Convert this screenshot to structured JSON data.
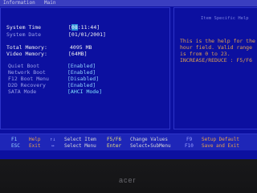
{
  "topbar": {
    "title": "Information",
    "tab": "Main"
  },
  "help": {
    "title": "Item Specific Help",
    "lines": [
      "This is the help for the",
      "hour field. Valid range",
      "is from 0 to 23.",
      "INCREASE/REDUCE : F5/F6"
    ]
  },
  "fields": [
    {
      "label": "System Time",
      "value_pre": "[",
      "value_hl": "08",
      "value_post": ":11:44]"
    },
    {
      "label": "System Date",
      "value": "[01/01/2001]"
    },
    {
      "label": "Total Memory:",
      "value": "4095 MB"
    },
    {
      "label": "Video Memory:",
      "value": "[64MB]"
    },
    {
      "label": "Quiet Boot",
      "value": "[Enabled]"
    },
    {
      "label": "Network Boot",
      "value": "[Enabled]"
    },
    {
      "label": "F12 Boot Menu",
      "value": "[Disabled]"
    },
    {
      "label": "D2D Recovery",
      "value": "[Enabled]"
    },
    {
      "label": "SATA Mode",
      "value": "[AHCI Mode]"
    }
  ],
  "footer": {
    "row1": {
      "k1": "F1",
      "a1": "Help",
      "k2": "↑↓",
      "a2": "Select Item",
      "k3": "F5/F6",
      "a3": "Change Values",
      "k4": "F9",
      "a4": "Setup Default"
    },
    "row2": {
      "k1": "ESC",
      "a1": "Exit",
      "k2": "↔",
      "a2": "Select Menu",
      "k3": "Enter",
      "a3": "Select▸SubMenu",
      "k4": "F10",
      "a4": "Save and Exit"
    }
  },
  "brand": "acer",
  "colors": {
    "screen_bg": "#0c10a0",
    "highlight": "#2a8fd8",
    "help_text": "#e0a050"
  }
}
